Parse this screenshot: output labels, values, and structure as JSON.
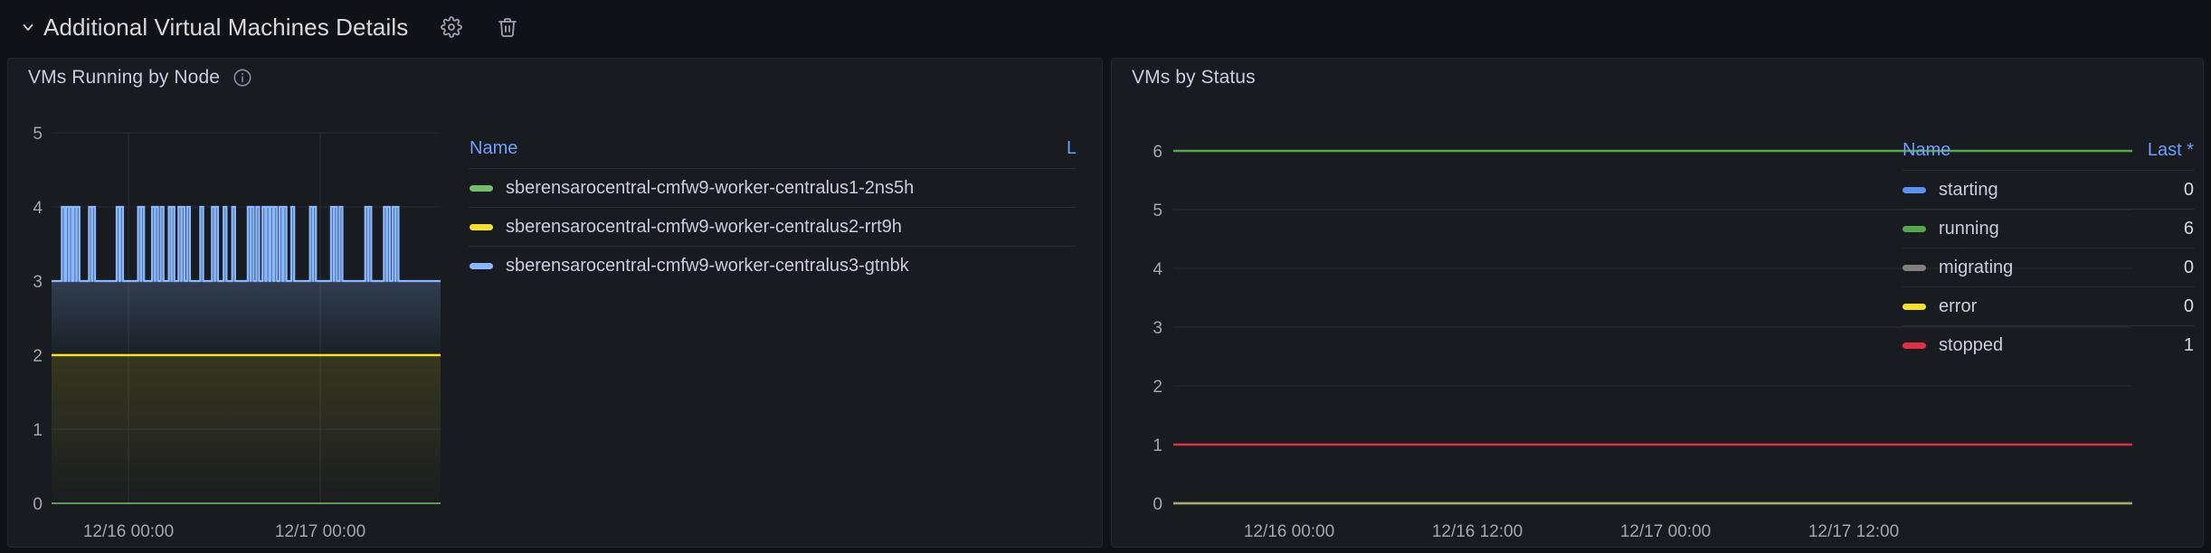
{
  "row": {
    "title": "Additional Virtual Machines Details",
    "collapse_icon": "chevron-down-icon",
    "settings_icon": "gear-icon",
    "delete_icon": "trash-icon"
  },
  "panels": [
    {
      "id": "vms-running-by-node",
      "title": "VMs Running by Node",
      "has_info_icon": true,
      "legend": {
        "columns": [
          "Name",
          "Last"
        ],
        "rows": [
          {
            "name": "sberensarocentral-cmfw9-worker-centralus1-2ns5h",
            "last": "",
            "color": "#73bf69"
          },
          {
            "name": "sberensarocentral-cmfw9-worker-centralus2-rrt9h",
            "last": "",
            "color": "#fade2a"
          },
          {
            "name": "sberensarocentral-cmfw9-worker-centralus3-gtnbk",
            "last": "",
            "color": "#8ab8ff"
          }
        ]
      },
      "chart_data": {
        "type": "line",
        "title": "VMs Running by Node",
        "xlabel": "",
        "ylabel": "",
        "ylim": [
          0,
          5
        ],
        "yticks": [
          0,
          1,
          2,
          3,
          4,
          5
        ],
        "xticks": [
          "12/16 00:00",
          "12/17 00:00"
        ],
        "grid": true,
        "legend_position": "right",
        "series": [
          {
            "name": "sberensarocentral-cmfw9-worker-centralus1-2ns5h",
            "color": "#73bf69",
            "constant_value": 0,
            "note": "flat at 0, hidden behind axis"
          },
          {
            "name": "sberensarocentral-cmfw9-worker-centralus2-rrt9h",
            "color": "#fade2a",
            "constant_value": 2,
            "note": "flat line at 2 with fill"
          },
          {
            "name": "sberensarocentral-cmfw9-worker-centralus3-gtnbk",
            "color": "#8ab8ff",
            "baseline": 3,
            "spike_value": 4,
            "note": "baseline 3 with frequent narrow spikes to 4",
            "spikes_x_fraction": [
              0.03,
              0.041,
              0.049,
              0.06,
              0.068,
              0.1,
              0.108,
              0.171,
              0.18,
              0.226,
              0.234,
              0.262,
              0.27,
              0.284,
              0.305,
              0.312,
              0.33,
              0.338,
              0.352,
              0.386,
              0.416,
              0.424,
              0.446,
              0.468,
              0.508,
              0.516,
              0.53,
              0.546,
              0.556,
              0.566,
              0.576,
              0.59,
              0.6,
              0.62,
              0.668,
              0.676,
              0.722,
              0.73,
              0.744,
              0.81,
              0.818,
              0.858,
              0.866,
              0.88,
              0.888
            ]
          }
        ]
      }
    },
    {
      "id": "vms-by-status",
      "title": "VMs by Status",
      "has_info_icon": false,
      "legend": {
        "columns": [
          "Name",
          "Last *"
        ],
        "rows": [
          {
            "name": "starting",
            "last": "0",
            "color": "#5794f2"
          },
          {
            "name": "running",
            "last": "6",
            "color": "#56a64b"
          },
          {
            "name": "migrating",
            "last": "0",
            "color": "#808080"
          },
          {
            "name": "error",
            "last": "0",
            "color": "#fade2a"
          },
          {
            "name": "stopped",
            "last": "1",
            "color": "#e02f44"
          }
        ]
      },
      "chart_data": {
        "type": "line",
        "title": "VMs by Status",
        "xlabel": "",
        "ylabel": "",
        "ylim": [
          0,
          6
        ],
        "yticks": [
          0,
          1,
          2,
          3,
          4,
          5,
          6
        ],
        "xticks": [
          "12/16 00:00",
          "12/16 12:00",
          "12/17 00:00",
          "12/17 12:00"
        ],
        "grid": true,
        "legend_position": "right",
        "series": [
          {
            "name": "starting",
            "color": "#5794f2",
            "constant_value": 0
          },
          {
            "name": "running",
            "color": "#56a64b",
            "constant_value": 6
          },
          {
            "name": "migrating",
            "color": "#808080",
            "constant_value": 0
          },
          {
            "name": "error",
            "color": "#fade2a",
            "constant_value": 0
          },
          {
            "name": "stopped",
            "color": "#e02f44",
            "constant_value": 1
          }
        ]
      }
    }
  ],
  "colors": {
    "page_bg": "#111217",
    "panel_bg": "#181b1f",
    "panel_border": "#24262b",
    "text_primary": "#ccccdc",
    "text_secondary": "#a4a6ab",
    "link_blue": "#6e9fff",
    "grid": "#2a2d33"
  }
}
